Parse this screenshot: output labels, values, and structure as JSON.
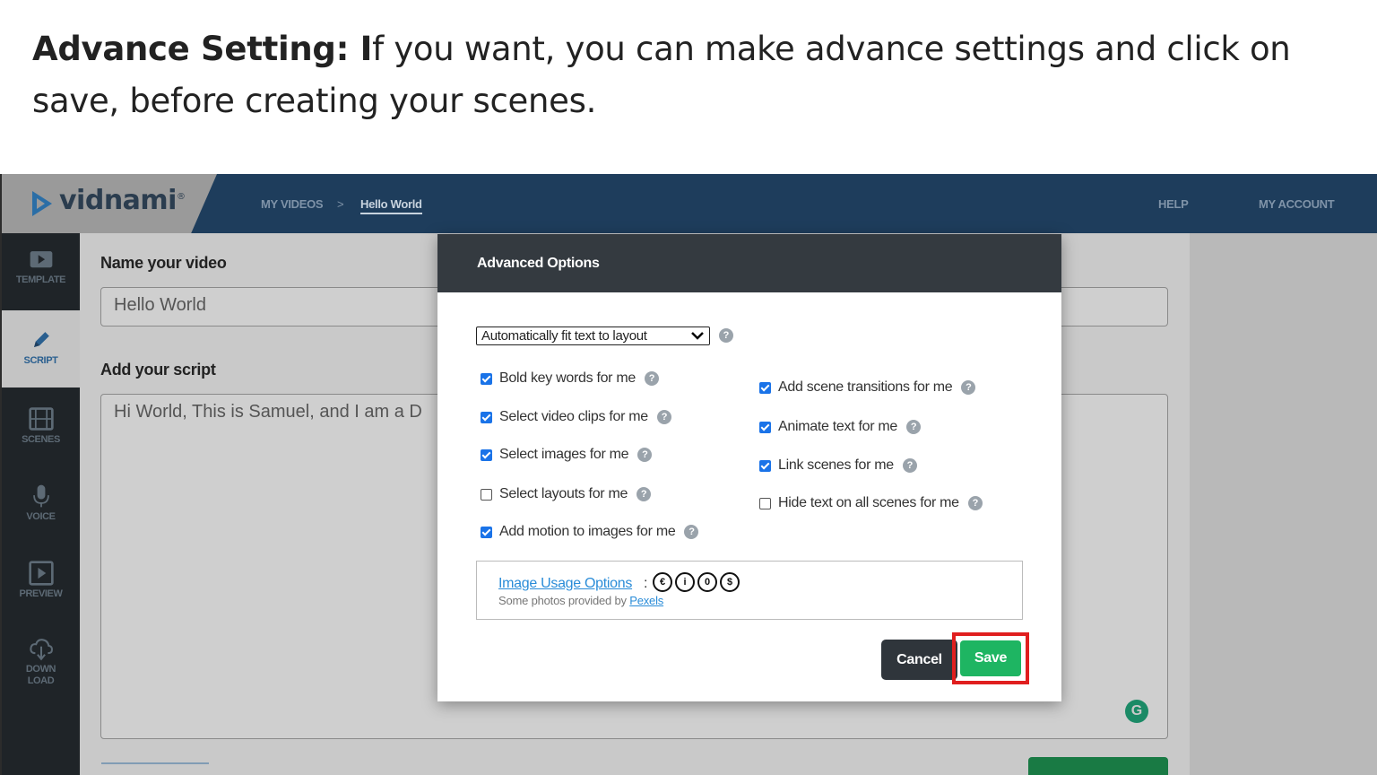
{
  "intro": {
    "bold": "Advance Setting: I",
    "rest": "f you want, you can make advance settings and click on save, before creating your scenes."
  },
  "app": {
    "logo": "vidnami",
    "breadcrumb": {
      "my_videos": "MY VIDEOS",
      "separator": ">",
      "current": "Hello World"
    },
    "nav": {
      "help": "HELP",
      "account": "MY ACCOUNT"
    },
    "sidebar": [
      {
        "label": "TEMPLATE",
        "icon": "play-icon"
      },
      {
        "label": "SCRIPT",
        "icon": "pencil-icon"
      },
      {
        "label": "SCENES",
        "icon": "film-icon"
      },
      {
        "label": "VOICE",
        "icon": "microphone-icon"
      },
      {
        "label": "PREVIEW",
        "icon": "preview-icon"
      },
      {
        "label": "DOWN LOAD",
        "icon": "download-icon"
      }
    ],
    "main": {
      "name_label": "Name your video",
      "name_value": "Hello World",
      "script_label": "Add your script",
      "script_value": "Hi World, This is Samuel, and I am a D"
    }
  },
  "modal": {
    "title": "Advanced Options",
    "fit_select": "Automatically fit text to layout",
    "options_left": [
      {
        "label": "Bold key words for me",
        "checked": true
      },
      {
        "label": "Select video clips for me",
        "checked": true
      },
      {
        "label": "Select images for me",
        "checked": true
      },
      {
        "label": "Select layouts for me",
        "checked": false
      },
      {
        "label": "Add motion to images for me",
        "checked": true
      }
    ],
    "options_right": [
      {
        "label": "Add scene transitions for me",
        "checked": true
      },
      {
        "label": "Animate text for me",
        "checked": true
      },
      {
        "label": "Link scenes for me",
        "checked": true
      },
      {
        "label": "Hide text on all scenes for me",
        "checked": false
      }
    ],
    "usage": {
      "link": "Image Usage Options",
      "colon": ":",
      "credit_prefix": "Some photos provided by",
      "credit_link": "Pexels"
    },
    "cancel": "Cancel",
    "save": "Save"
  },
  "colors": {
    "topbar": "#1e3d5c",
    "save_button": "#1eb562",
    "highlight_box": "#e01e1e",
    "checkbox_on": "#1a73e8"
  }
}
